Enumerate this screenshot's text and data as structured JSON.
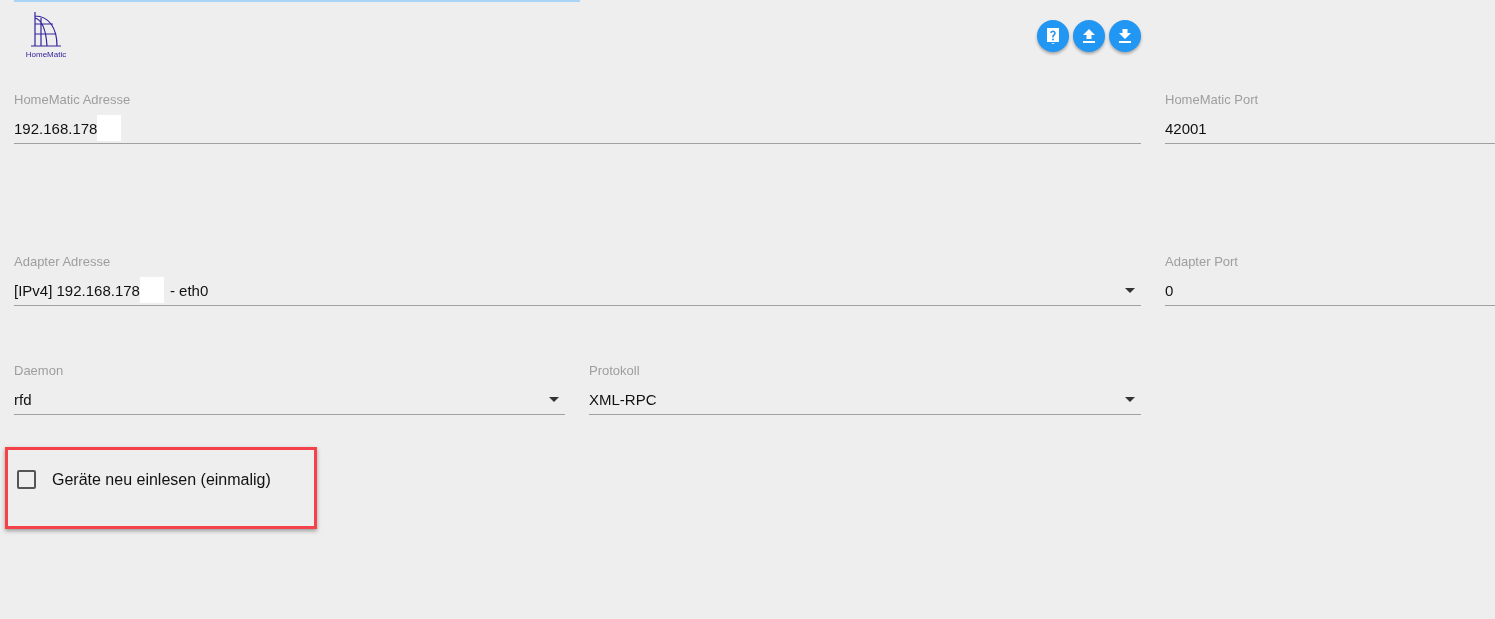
{
  "logo": {
    "text": "HomeMatic"
  },
  "toolbar": [
    {
      "kind": "help"
    },
    {
      "kind": "upload"
    },
    {
      "kind": "download"
    }
  ],
  "rows": [
    {
      "fields": [
        {
          "label": "HomeMatic Adresse",
          "value": "192.168.178",
          "redacted": true,
          "dropdown": false
        },
        {
          "label": "HomeMatic Port",
          "value": "42001",
          "redacted": false,
          "dropdown": false
        }
      ]
    },
    {
      "fields": [
        {
          "label": "Adapter Adresse",
          "value": "[IPv4] 192.168.178",
          "redacted": true,
          "value_suffix": "- eth0",
          "dropdown": true
        },
        {
          "label": "Adapter Port",
          "value": "0",
          "redacted": false,
          "dropdown": false
        }
      ]
    }
  ],
  "selects": [
    {
      "label": "Daemon",
      "value": "rfd"
    },
    {
      "label": "Protokoll",
      "value": "XML-RPC"
    }
  ],
  "checkbox": {
    "label": "Geräte neu einlesen (einmalig)",
    "checked": false,
    "highlighted": true
  }
}
